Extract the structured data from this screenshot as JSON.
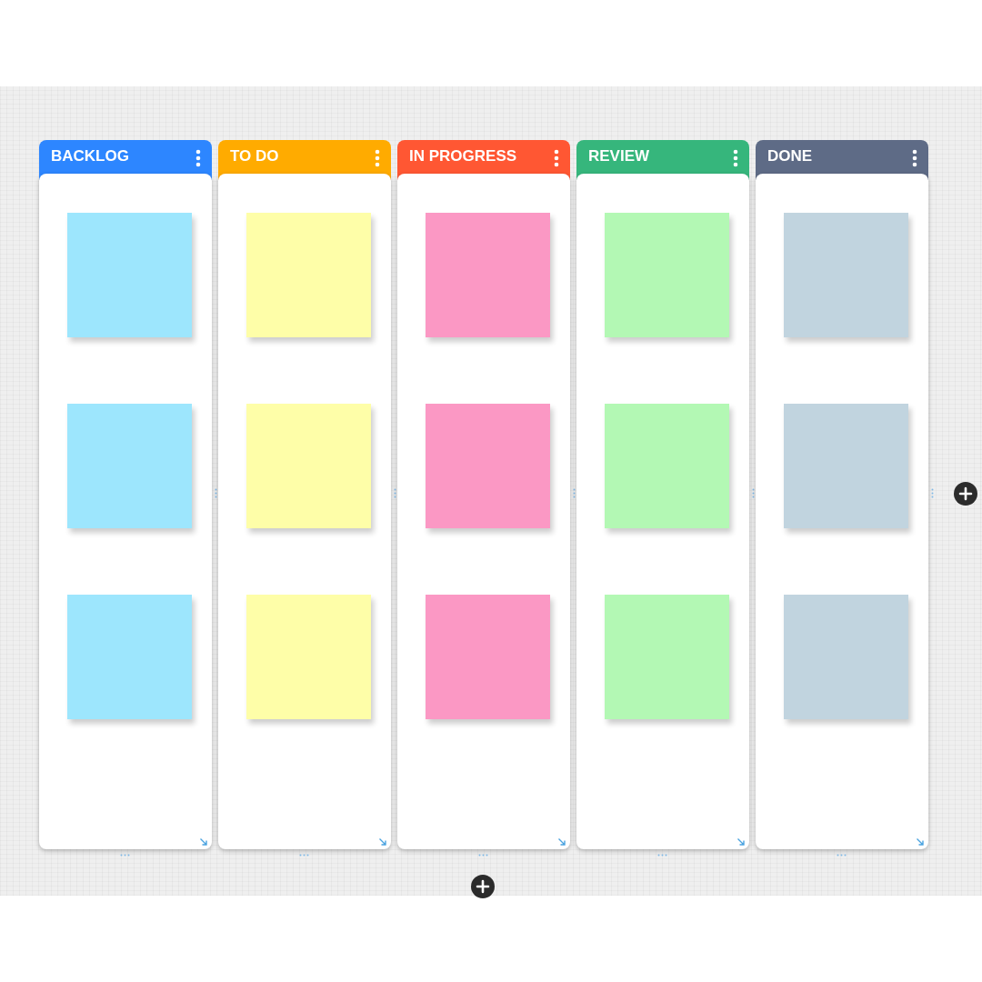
{
  "board": {
    "columns": [
      {
        "title": "BACKLOG",
        "color": "#2d86ff",
        "notes": [
          {
            "color": "#9de6fd"
          },
          {
            "color": "#9de6fd"
          },
          {
            "color": "#9de6fd"
          }
        ]
      },
      {
        "title": "TO DO",
        "color": "#ffab00",
        "notes": [
          {
            "color": "#fefea8"
          },
          {
            "color": "#fefea8"
          },
          {
            "color": "#fefea8"
          }
        ]
      },
      {
        "title": "IN PROGRESS",
        "color": "#ff5733",
        "notes": [
          {
            "color": "#fb98c4"
          },
          {
            "color": "#fb98c4"
          },
          {
            "color": "#fb98c4"
          }
        ]
      },
      {
        "title": "REVIEW",
        "color": "#36b67c",
        "notes": [
          {
            "color": "#b3f8b4"
          },
          {
            "color": "#b3f8b4"
          },
          {
            "color": "#b3f8b4"
          }
        ]
      },
      {
        "title": "DONE",
        "color": "#5e6b86",
        "notes": [
          {
            "color": "#c1d4df"
          },
          {
            "color": "#c1d4df"
          },
          {
            "color": "#c1d4df"
          }
        ]
      }
    ]
  }
}
